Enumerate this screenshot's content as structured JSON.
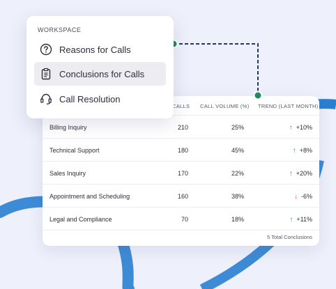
{
  "menu": {
    "heading": "WORKSPACE",
    "items": [
      {
        "label": "Reasons for Calls",
        "icon": "question-circle-icon",
        "active": false
      },
      {
        "label": "Conclusions for Calls",
        "icon": "clipboard-icon",
        "active": true
      },
      {
        "label": "Call Resolution",
        "icon": "headset-icon",
        "active": false
      }
    ]
  },
  "table": {
    "headers": {
      "calls": "CALLS",
      "volume": "CALL VOLUME (%)",
      "trend": "TREND (LAST MONTH)"
    },
    "rows": [
      {
        "name": "Billing Inquiry",
        "calls": "210",
        "volume": "25%",
        "trend": "+10%",
        "direction": "up"
      },
      {
        "name": "Technical Support",
        "calls": "180",
        "volume": "45%",
        "trend": "+8%",
        "direction": "up"
      },
      {
        "name": "Sales Inquiry",
        "calls": "170",
        "volume": "22%",
        "trend": "+20%",
        "direction": "up"
      },
      {
        "name": "Appointment and Scheduling",
        "calls": "160",
        "volume": "38%",
        "trend": "-6%",
        "direction": "down"
      },
      {
        "name": "Legal and Compliance",
        "calls": "70",
        "volume": "18%",
        "trend": "+11%",
        "direction": "up"
      }
    ],
    "footer": "5 Total Conclusions"
  },
  "colors": {
    "accent_dot": "#1f8a5c",
    "connector": "#22357a",
    "swoosh": "#2a7fd0",
    "trend_up": "#2f9a56",
    "trend_down": "#d9534f"
  }
}
